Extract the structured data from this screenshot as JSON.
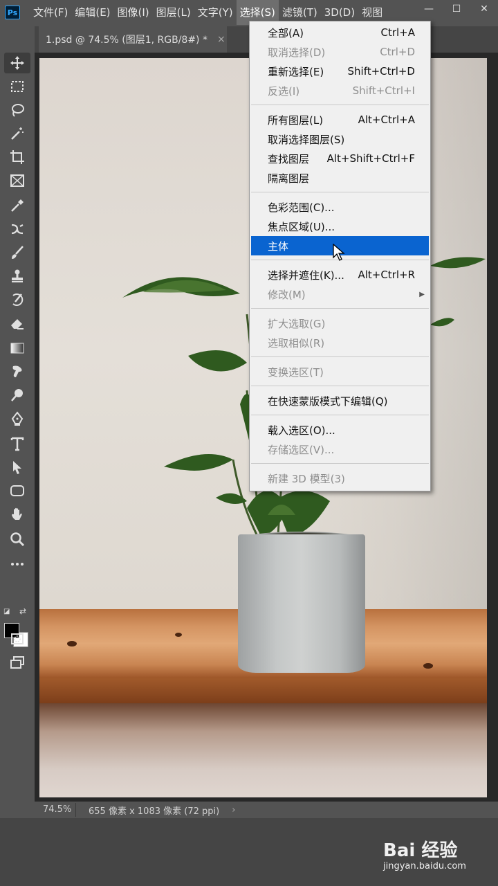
{
  "app": {
    "logo": "Ps"
  },
  "menubar": {
    "items": [
      "文件(F)",
      "编辑(E)",
      "图像(I)",
      "图层(L)",
      "文字(Y)",
      "选择(S)",
      "滤镜(T)",
      "3D(D)",
      "视图"
    ],
    "active_index": 5
  },
  "window_controls": {
    "minimize": "—",
    "maximize": "☐",
    "close": "✕"
  },
  "document_tab": {
    "title": "1.psd @ 74.5% (图层1, RGB/8#) *",
    "close": "×"
  },
  "toolbar": {
    "tools": [
      "move-tool",
      "marquee-tool",
      "lasso-tool",
      "magic-wand-tool",
      "crop-tool",
      "frame-tool",
      "eyedropper-tool",
      "healing-tool",
      "brush-tool",
      "stamp-tool",
      "history-brush-tool",
      "eraser-tool",
      "gradient-tool",
      "smudge-tool",
      "dodge-tool",
      "pen-tool",
      "type-tool",
      "path-select-tool",
      "shape-tool",
      "hand-tool",
      "zoom-tool",
      "more-tools"
    ],
    "foreground_color": "#000000",
    "background_color": "#ffffff"
  },
  "select_menu": {
    "items": [
      {
        "label": "全部(A)",
        "shortcut": "Ctrl+A",
        "enabled": true
      },
      {
        "label": "取消选择(D)",
        "shortcut": "Ctrl+D",
        "enabled": false
      },
      {
        "label": "重新选择(E)",
        "shortcut": "Shift+Ctrl+D",
        "enabled": true
      },
      {
        "label": "反选(I)",
        "shortcut": "Shift+Ctrl+I",
        "enabled": false
      },
      {
        "label": "所有图层(L)",
        "shortcut": "Alt+Ctrl+A",
        "enabled": true
      },
      {
        "label": "取消选择图层(S)",
        "shortcut": "",
        "enabled": true
      },
      {
        "label": "查找图层",
        "shortcut": "Alt+Shift+Ctrl+F",
        "enabled": true
      },
      {
        "label": "隔离图层",
        "shortcut": "",
        "enabled": true
      },
      {
        "label": "色彩范围(C)...",
        "shortcut": "",
        "enabled": true
      },
      {
        "label": "焦点区域(U)...",
        "shortcut": "",
        "enabled": true
      },
      {
        "label": "主体",
        "shortcut": "",
        "enabled": true,
        "highlighted": true
      },
      {
        "label": "选择并遮住(K)...",
        "shortcut": "Alt+Ctrl+R",
        "enabled": true
      },
      {
        "label": "修改(M)",
        "shortcut": "",
        "enabled": false,
        "submenu": true
      },
      {
        "label": "扩大选取(G)",
        "shortcut": "",
        "enabled": false
      },
      {
        "label": "选取相似(R)",
        "shortcut": "",
        "enabled": false
      },
      {
        "label": "变换选区(T)",
        "shortcut": "",
        "enabled": false
      },
      {
        "label": "在快速蒙版模式下编辑(Q)",
        "shortcut": "",
        "enabled": true
      },
      {
        "label": "载入选区(O)...",
        "shortcut": "",
        "enabled": true
      },
      {
        "label": "存储选区(V)...",
        "shortcut": "",
        "enabled": false
      },
      {
        "label": "新建 3D 模型(3)",
        "shortcut": "",
        "enabled": false
      }
    ],
    "highlight_color": "#0a64d0"
  },
  "statusbar": {
    "zoom": "74.5%",
    "doc_info": "655 像素 x 1083 像素 (72 ppi)",
    "arrow": "›"
  },
  "watermark": {
    "main": "Bai 经验",
    "sub": "jingyan.baidu.com"
  }
}
